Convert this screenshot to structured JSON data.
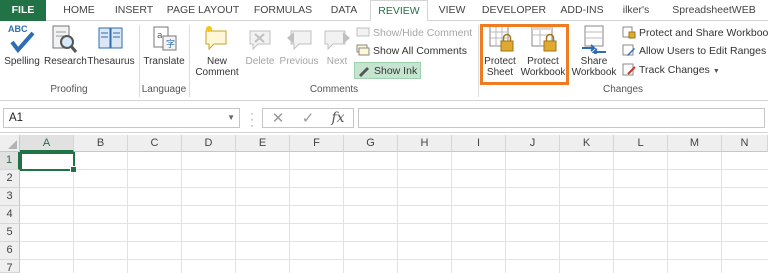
{
  "tabs": [
    {
      "label": "FILE"
    },
    {
      "label": "HOME"
    },
    {
      "label": "INSERT"
    },
    {
      "label": "PAGE LAYOUT"
    },
    {
      "label": "FORMULAS"
    },
    {
      "label": "DATA"
    },
    {
      "label": "REVIEW"
    },
    {
      "label": "VIEW"
    },
    {
      "label": "DEVELOPER"
    },
    {
      "label": "ADD-INS"
    },
    {
      "label": "ilker's"
    },
    {
      "label": "SpreadsheetWEB"
    }
  ],
  "active_tab": "REVIEW",
  "colors": {
    "excel_green": "#217346",
    "highlight_orange": "#ef7c22",
    "show_ink_bg": "#c5e5d1"
  },
  "ribbon": {
    "proofing": {
      "label": "Proofing",
      "spelling": "Spelling",
      "abc": "ABC",
      "research": "Research",
      "thesaurus": "Thesaurus"
    },
    "language": {
      "label": "Language",
      "translate": "Translate"
    },
    "comments": {
      "label": "Comments",
      "new_line1": "New",
      "new_line2": "Comment",
      "delete": "Delete",
      "previous": "Previous",
      "next": "Next",
      "show_hide": "Show/Hide Comment",
      "show_all": "Show All Comments",
      "show_ink": "Show Ink"
    },
    "changes": {
      "label": "Changes",
      "protect_sheet_1": "Protect",
      "protect_sheet_2": "Sheet",
      "protect_wb_1": "Protect",
      "protect_wb_2": "Workbook",
      "share_1": "Share",
      "share_2": "Workbook",
      "protect_share": "Protect and Share Workbook",
      "allow_users": "Allow Users to Edit Ranges",
      "track_changes": "Track Changes"
    }
  },
  "formula_bar": {
    "name_box": "A1",
    "fx": "fx",
    "cancel_glyph": "✕",
    "enter_glyph": "✓",
    "formula_value": ""
  },
  "grid": {
    "columns": [
      "A",
      "B",
      "C",
      "D",
      "E",
      "F",
      "G",
      "H",
      "I",
      "J",
      "K",
      "L",
      "M",
      "N"
    ],
    "rows": [
      "1",
      "2",
      "3",
      "4",
      "5",
      "6",
      "7"
    ],
    "selected_cell": "A1"
  }
}
